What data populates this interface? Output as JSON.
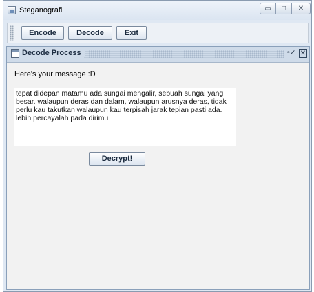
{
  "window": {
    "title": "Steganografi",
    "controls": {
      "minimize": "▭",
      "maximize": "□",
      "close": "✕"
    }
  },
  "toolbar": {
    "encode_label": "Encode",
    "decode_label": "Decode",
    "exit_label": "Exit"
  },
  "frame": {
    "title": "Decode Process",
    "restore_glyph": "▫↙",
    "close_glyph": "✕",
    "heading": "Here's your message :D",
    "message": "tepat didepan matamu ada sungai mengalir, sebuah sungai yang besar. walaupun deras dan dalam, walaupun arusnya deras, tidak perlu kau takutkan walaupun kau terpisah jarak tepian pasti ada. lebih percayalah pada dirimu",
    "decrypt_label": "Decrypt!"
  },
  "icons": [
    "app-icon",
    "frame-icon",
    "restore-icon",
    "close-icon"
  ]
}
